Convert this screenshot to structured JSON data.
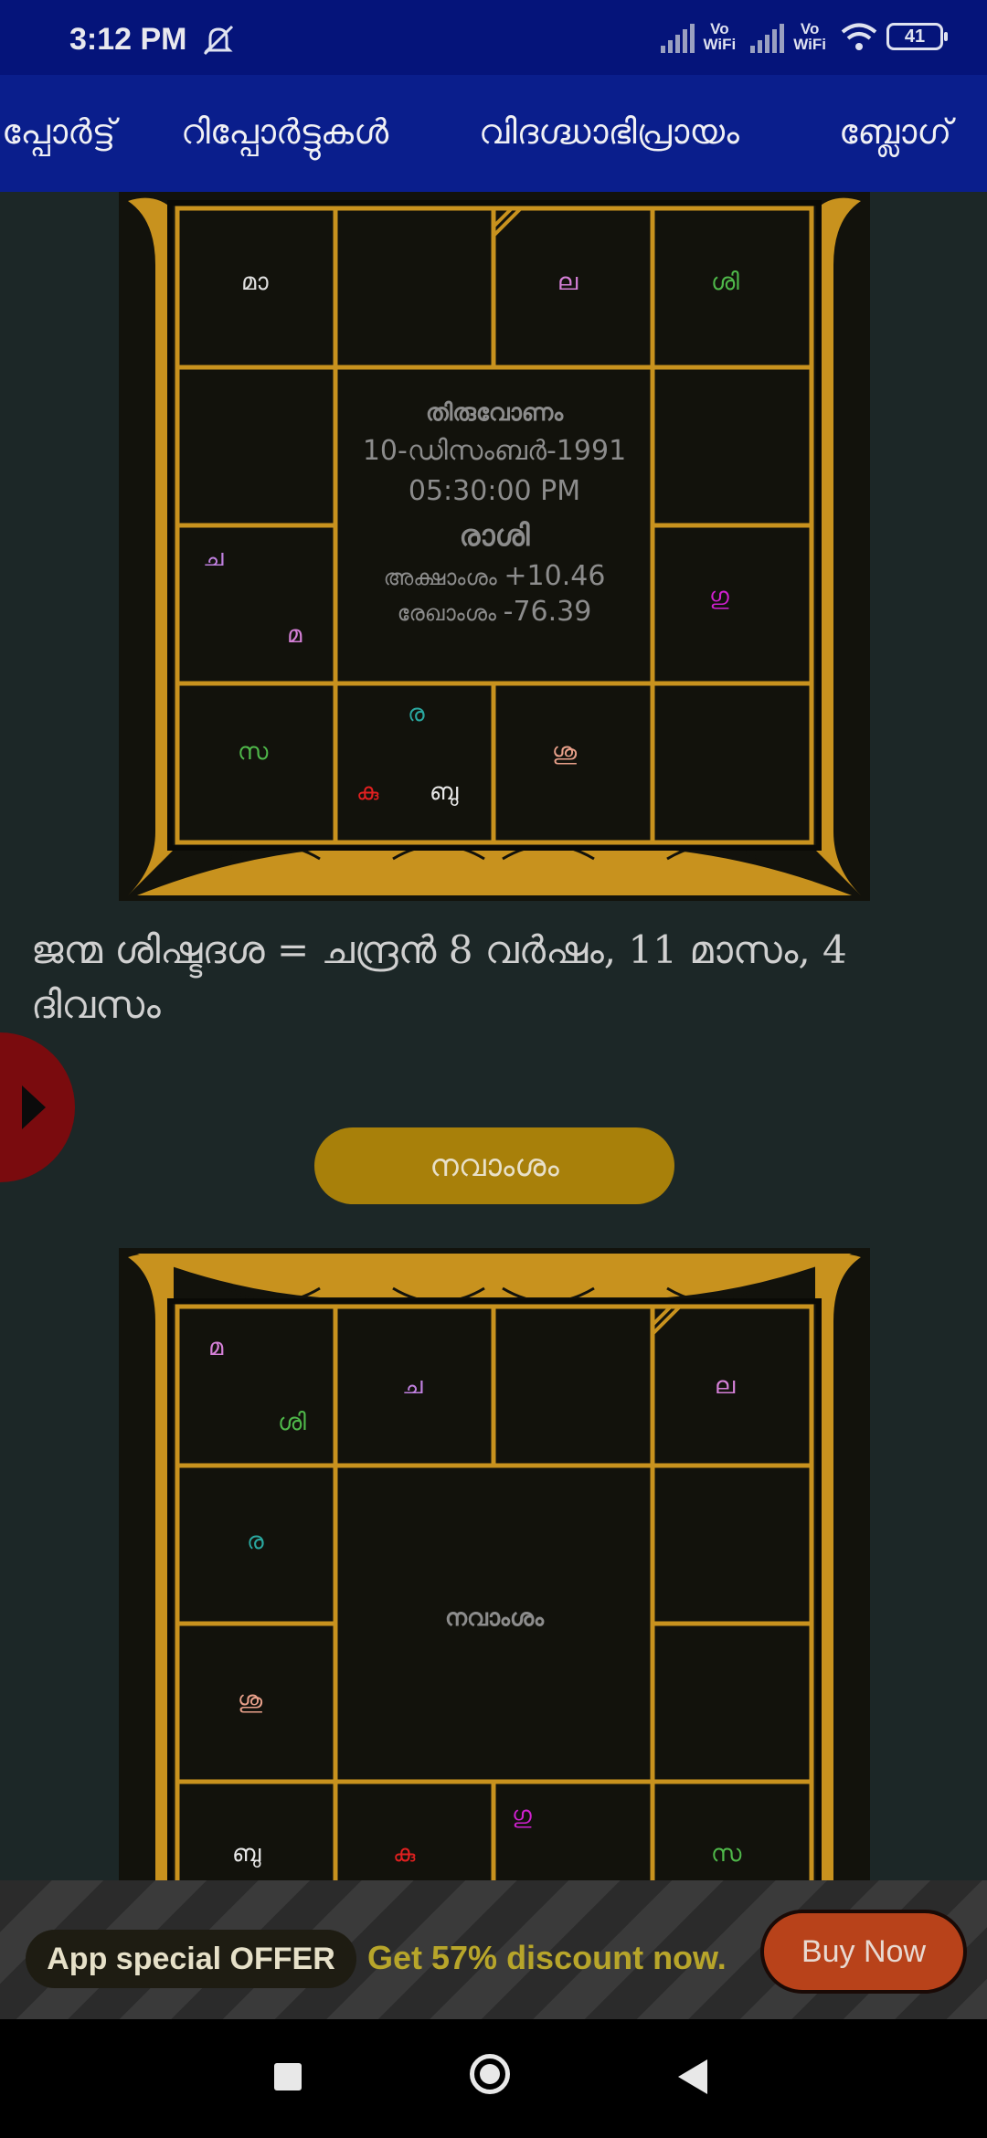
{
  "status_bar": {
    "time": "3:12 PM",
    "mute_icon": "bell-off-icon",
    "vowifi_1": "Vo\nWiFi",
    "vowifi_2": "Vo\nWiFi",
    "battery": "41"
  },
  "nav": {
    "items": [
      "പ്പോർട്ട്",
      "റിപ്പോർട്ടുകൾ",
      "വിദഗ്ദ്ധാഭിപ്രായം",
      "ബ്ലോഗ്"
    ]
  },
  "rasi_chart": {
    "cells": {
      "r0c0": [
        "മാ"
      ],
      "r0c2": [
        "ല"
      ],
      "r0c3": [
        "ശി"
      ],
      "r2c0": [
        "ച",
        "മ"
      ],
      "r2c3": [
        "ഗു"
      ],
      "r3c1": [
        "ര",
        "കു",
        "ബു"
      ],
      "r3c0": [
        "സ"
      ],
      "r3c2": [
        "ശു"
      ]
    },
    "center": {
      "nakshatra": "തിരുവോണം",
      "date": "10-ഡിസംബർ-1991",
      "time": "05:30:00 PM",
      "title": "രാശി",
      "lat_label": "അക്ഷാംശം",
      "lat_value": "+10.46",
      "lon_label": "രേഖാംശം",
      "lon_value": "-76.39"
    }
  },
  "dasha": {
    "line1": "ജന്മ ശിഷ്ടദശ = ചന്ദ്രൻ 8 വർഷം, 11 മാസം, 4",
    "line2": "ദിവസം"
  },
  "navamsa_button": "നവാംശം",
  "navamsa_chart": {
    "center_title": "നവാംശം",
    "cells": {
      "r0c0": [
        "മ",
        "ശി"
      ],
      "r0c1": [
        "ച"
      ],
      "r0c3": [
        "ല"
      ],
      "r1c0": [
        "ര"
      ],
      "r2c0": [
        "ശു"
      ],
      "r3c0": [
        "ബു"
      ],
      "r3c1": [
        "കു"
      ],
      "r3c2": [
        "ഗു"
      ],
      "r3c3": [
        "സ"
      ]
    }
  },
  "offer": {
    "pill": "App special OFFER",
    "text": "Get 57% discount now.",
    "button": "Buy Now"
  },
  "colors": {
    "status_bg": "#05147a",
    "nav_bg": "#0a1e8c",
    "page_bg": "#1c2727",
    "gold": "#c8921e",
    "chart_bg": "#12120c"
  }
}
